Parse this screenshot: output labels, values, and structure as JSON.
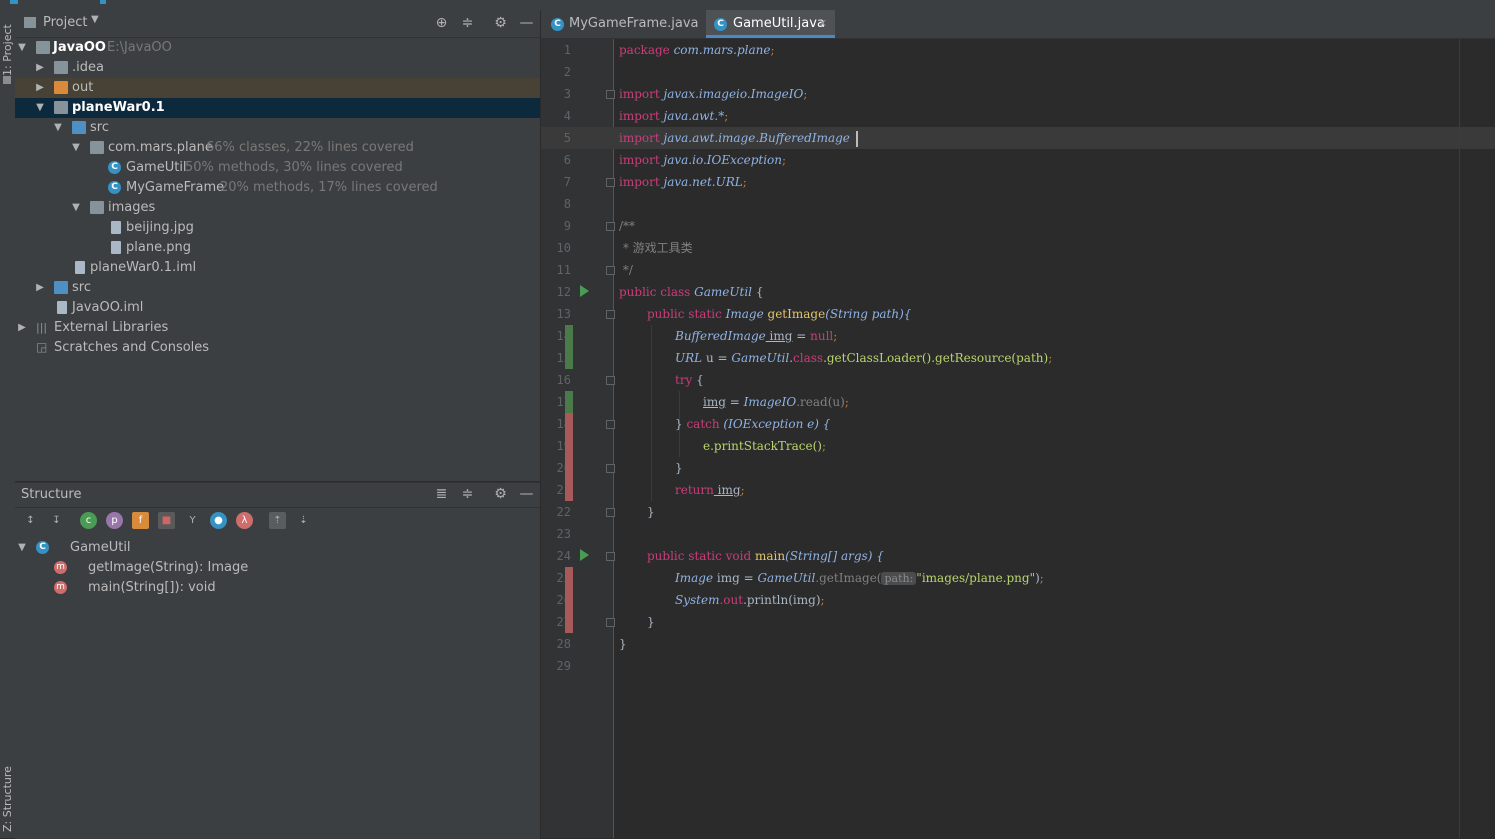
{
  "project_panel": {
    "title": "Project",
    "tree": [
      {
        "name": "JavaOO",
        "extra": "E:\\JavaOO"
      },
      {
        "name": ".idea",
        "extra": ""
      },
      {
        "name": "out",
        "extra": ""
      },
      {
        "name": "planeWar0.1",
        "extra": ""
      },
      {
        "name": "src",
        "extra": ""
      },
      {
        "name": "com.mars.plane",
        "extra": "66% classes, 22% lines covered"
      },
      {
        "name": "GameUtil",
        "extra": "50% methods, 30% lines covered"
      },
      {
        "name": "MyGameFrame",
        "extra": "20% methods, 17% lines covered"
      },
      {
        "name": "images",
        "extra": ""
      },
      {
        "name": "beijing.jpg",
        "extra": ""
      },
      {
        "name": "plane.png",
        "extra": ""
      },
      {
        "name": "planeWar0.1.iml",
        "extra": ""
      },
      {
        "name": "src",
        "extra": ""
      },
      {
        "name": "JavaOO.iml",
        "extra": ""
      },
      {
        "name": "External Libraries",
        "extra": ""
      },
      {
        "name": "Scratches and Consoles",
        "extra": ""
      }
    ]
  },
  "side_tabs": {
    "project": "1: Project",
    "structure": "Z: Structure"
  },
  "structure_panel": {
    "title": "Structure",
    "class_name": "GameUtil",
    "members": [
      "getImage(String): Image",
      "main(String[]): void"
    ]
  },
  "editor": {
    "tabs": [
      "MyGameFrame.java",
      "GameUtil.java"
    ],
    "active_tab": "GameUtil.java",
    "line_numbers": [
      "1",
      "2",
      "3",
      "4",
      "5",
      "6",
      "7",
      "8",
      "9",
      "10",
      "11",
      "12",
      "13",
      "14",
      "15",
      "16",
      "17",
      "18",
      "19",
      "20",
      "21",
      "22",
      "23",
      "24",
      "25",
      "26",
      "27",
      "28",
      "29"
    ],
    "code": {
      "l1_kw": "package",
      "l1_rest": " com.mars.plane",
      "semi": ";",
      "l3_kw": "import",
      "l3_rest": " javax.imageio.ImageIO",
      "l4_rest": " java.awt.*",
      "l5_rest": " java.awt.image.BufferedImage",
      "l6_rest": " java.io.IOException",
      "l7_rest": " java.net.URL",
      "l9": "/**",
      "l10": " * 游戏工具类",
      "l11": " */",
      "l12_kw": "public class",
      "l12_name": " GameUtil",
      "brace_open": " {",
      "l13_kw": "public static",
      "l13_type": " Image",
      "l13_fn": " getImage",
      "l13_params": "(String path){",
      "l14_type": "BufferedImage",
      "l14_var": " img",
      "l14_eq": " = ",
      "l14_null": "null",
      "l15_type": "URL",
      "l15_rest": " u = ",
      "l15_cls": "GameUtil",
      "l15_dot": ".",
      "l15_kw": "class",
      "l15_call": ".getClassLoader().getResource(path)",
      "l16_kw": "try",
      "l17_var": "img",
      "l17_eq": " = ",
      "l17_cls": "ImageIO",
      "l17_call": ".read(u)",
      "l18_close": "} ",
      "l18_kw": "catch",
      "l18_params": " (IOException e) {",
      "l19": "e.printStackTrace()",
      "l20": "}",
      "l21_kw": "return",
      "l21_var": " img",
      "l22": "}",
      "l24_kw": "public static void",
      "l24_fn": " main",
      "l24_params": "(String[] args) {",
      "l25_type": "Image",
      "l25_var": " img = ",
      "l25_cls": "GameUtil",
      "l25_call": ".getImage(",
      "l25_hint": "path:",
      "l25_str": "\"images/plane.png\"",
      "l25_close": ")",
      "l26_cls": "System",
      "l26_out": ".out",
      "l26_call": ".println(img)",
      "l27": "}",
      "l28": "}"
    }
  }
}
